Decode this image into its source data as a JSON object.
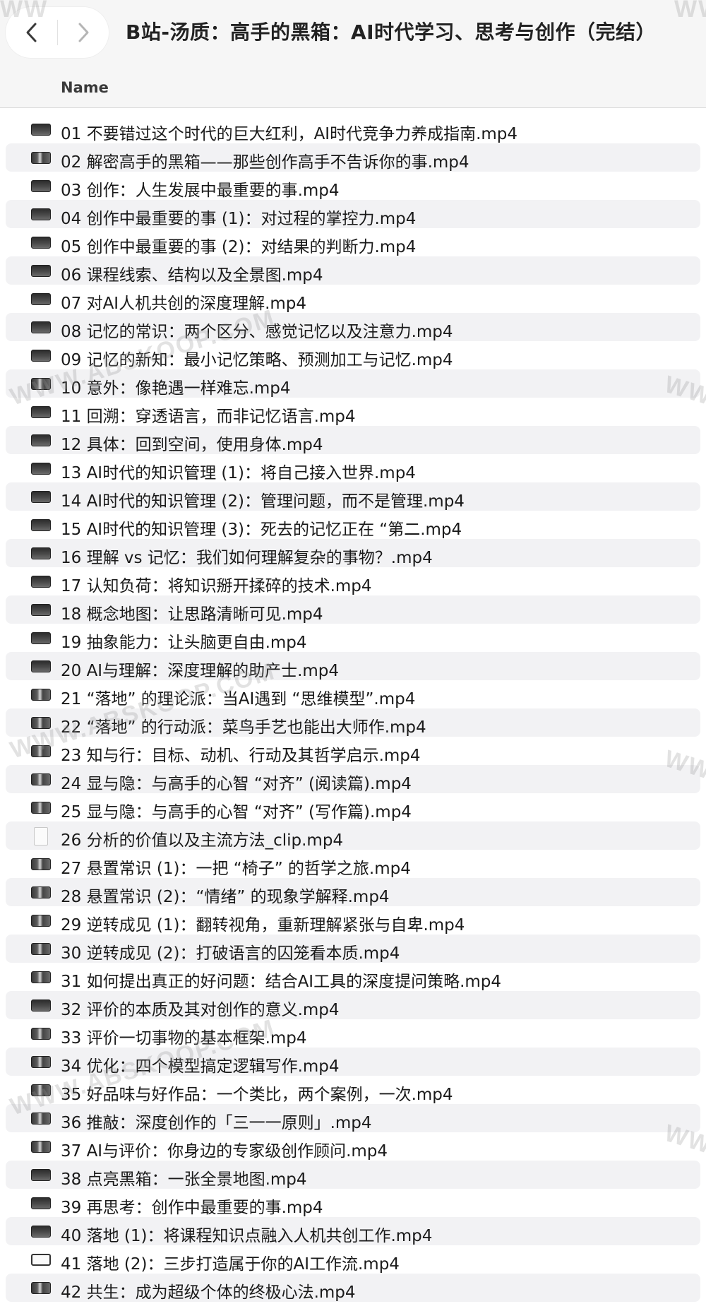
{
  "window": {
    "title": "B站-汤质：高手的黑箱：AI时代学习、思考与创作（完结）"
  },
  "icons": {
    "back": "chevron-left-icon",
    "forward": "chevron-right-icon",
    "video": "video-file-icon",
    "document": "document-file-icon"
  },
  "columns": {
    "name": "Name"
  },
  "files": [
    {
      "name": "01 不要错过这个时代的巨大红利，AI时代竞争力养成指南.mp4",
      "icon": "video"
    },
    {
      "name": "02 解密高手的黑箱——那些创作高手不告诉你的事.mp4",
      "icon": "thumb"
    },
    {
      "name": "03 创作：人生发展中最重要的事.mp4",
      "icon": "video"
    },
    {
      "name": "04 创作中最重要的事 (1)：对过程的掌控力.mp4",
      "icon": "video"
    },
    {
      "name": "05 创作中最重要的事 (2)：对结果的判断力.mp4",
      "icon": "video"
    },
    {
      "name": "06 课程线索、结构以及全景图.mp4",
      "icon": "video"
    },
    {
      "name": "07 对AI人机共创的深度理解.mp4",
      "icon": "video"
    },
    {
      "name": "08 记忆的常识：两个区分、感觉记忆以及注意力.mp4",
      "icon": "video"
    },
    {
      "name": "09 记忆的新知：最小记忆策略、预测加工与记忆.mp4",
      "icon": "video"
    },
    {
      "name": "10 意外：像艳遇一样难忘.mp4",
      "icon": "thumb"
    },
    {
      "name": "11 回溯：穿透语言，而非记忆语言.mp4",
      "icon": "video"
    },
    {
      "name": "12 具体：回到空间，使用身体.mp4",
      "icon": "video"
    },
    {
      "name": "13 AI时代的知识管理 (1)：将自己接入世界.mp4",
      "icon": "video"
    },
    {
      "name": "14 AI时代的知识管理 (2)：管理问题，而不是管理.mp4",
      "icon": "video"
    },
    {
      "name": "15 AI时代的知识管理 (3)：死去的记忆正在 “第二.mp4",
      "icon": "video"
    },
    {
      "name": "16 理解 vs 记忆：我们如何理解复杂的事物？.mp4",
      "icon": "video"
    },
    {
      "name": "17 认知负荷：将知识掰开揉碎的技术.mp4",
      "icon": "video"
    },
    {
      "name": "18 概念地图：让思路清晰可见.mp4",
      "icon": "video"
    },
    {
      "name": "19 抽象能力：让头脑更自由.mp4",
      "icon": "video"
    },
    {
      "name": "20 AI与理解：深度理解的助产士.mp4",
      "icon": "video"
    },
    {
      "name": "21 “落地” 的理论派：当AI遇到 “思维模型”.mp4",
      "icon": "thumb"
    },
    {
      "name": "22 “落地” 的行动派：菜鸟手艺也能出大师作.mp4",
      "icon": "thumb"
    },
    {
      "name": "23 知与行：目标、动机、行动及其哲学启示.mp4",
      "icon": "thumb"
    },
    {
      "name": "24 显与隐：与高手的心智 “对齐” (阅读篇).mp4",
      "icon": "thumb"
    },
    {
      "name": "25 显与隐：与高手的心智 “对齐” (写作篇).mp4",
      "icon": "thumb"
    },
    {
      "name": "26 分析的价值以及主流方法_clip.mp4",
      "icon": "doc"
    },
    {
      "name": "27 悬置常识 (1)：一把 “椅子” 的哲学之旅.mp4",
      "icon": "thumb"
    },
    {
      "name": "28 悬置常识 (2)：“情绪” 的现象学解释.mp4",
      "icon": "thumb"
    },
    {
      "name": "29 逆转成见 (1)：翻转视角，重新理解紧张与自卑.mp4",
      "icon": "thumb"
    },
    {
      "name": "30 逆转成见 (2)：打破语言的囚笼看本质.mp4",
      "icon": "thumb"
    },
    {
      "name": "31 如何提出真正的好问题：结合AI工具的深度提问策略.mp4",
      "icon": "thumb"
    },
    {
      "name": "32 评价的本质及其对创作的意义.mp4",
      "icon": "video"
    },
    {
      "name": "33 评价一切事物的基本框架.mp4",
      "icon": "thumb"
    },
    {
      "name": "34 优化：四个模型搞定逻辑写作.mp4",
      "icon": "thumb"
    },
    {
      "name": "35 好品味与好作品：一个类比，两个案例，一次.mp4",
      "icon": "thumb"
    },
    {
      "name": "36 推敲：深度创作的「三一一原则」.mp4",
      "icon": "thumb"
    },
    {
      "name": "37 AI与评价：你身边的专家级创作顾问.mp4",
      "icon": "thumb"
    },
    {
      "name": "38 点亮黑箱：一张全景地图.mp4",
      "icon": "video"
    },
    {
      "name": "39 再思考：创作中最重要的事.mp4",
      "icon": "video"
    },
    {
      "name": "40 落地 (1)：将课程知识点融入人机共创工作.mp4",
      "icon": "video"
    },
    {
      "name": "41 落地 (2)：三步打造属于你的AI工作流.mp4",
      "icon": "white"
    },
    {
      "name": "42 共生：成为超级个体的终极心法.mp4",
      "icon": "thumb"
    }
  ],
  "watermarks": {
    "text_full": "WWW.ABSKOOP.COM",
    "text_partial": "WW"
  }
}
